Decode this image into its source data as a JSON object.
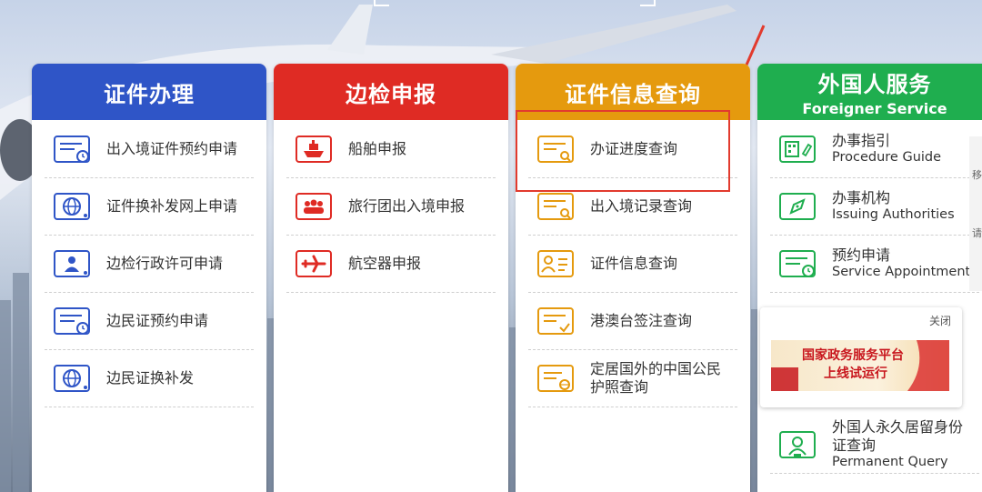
{
  "columns": [
    {
      "title": "证件办理",
      "color": "#2f55c7",
      "items": [
        {
          "label": "出入境证件预约申请",
          "icon": "document-clock-icon"
        },
        {
          "label": "证件换补发网上申请",
          "icon": "globe-icon"
        },
        {
          "label": "边检行政许可申请",
          "icon": "person-id-icon"
        },
        {
          "label": "边民证预约申请",
          "icon": "document-clock-icon"
        },
        {
          "label": "边民证换补发",
          "icon": "globe-icon"
        }
      ]
    },
    {
      "title": "边检申报",
      "color": "#df2b24",
      "items": [
        {
          "label": "船舶申报",
          "icon": "ship-icon"
        },
        {
          "label": "旅行团出入境申报",
          "icon": "group-icon"
        },
        {
          "label": "航空器申报",
          "icon": "airplane-icon"
        }
      ]
    },
    {
      "title": "证件信息查询",
      "color": "#e59a0e",
      "items": [
        {
          "label": "办证进度查询",
          "icon": "document-search-icon"
        },
        {
          "label": "出入境记录查询",
          "icon": "document-search-icon"
        },
        {
          "label": "证件信息查询",
          "icon": "person-card-icon"
        },
        {
          "label": "港澳台签注查询",
          "icon": "document-check-icon"
        },
        {
          "label": "定居国外的中国公民护照查询",
          "line1": "定居国外的中国公民",
          "line2": "护照查询",
          "icon": "passport-globe-icon"
        }
      ]
    },
    {
      "title": "外国人服务",
      "subtitle": "Foreigner Service",
      "color": "#1fae4f",
      "items": [
        {
          "label": "办事指引",
          "sub": "Procedure Guide",
          "icon": "guide-icon"
        },
        {
          "label": "办事机构",
          "sub": "Issuing Authorities",
          "icon": "compass-icon"
        },
        {
          "label": "预约申请",
          "sub": "Service Appointment",
          "icon": "document-clock-icon"
        },
        {
          "label": "外国人永久居留身份证查询",
          "line1": "外国人永久居留身份",
          "line2": "证查询",
          "sub": "Permanent Query",
          "icon": "resident-card-icon"
        }
      ]
    }
  ],
  "popup": {
    "close_label": "关闭",
    "banner_line1": "国家政务服务平台",
    "banner_line2": "上线试运行"
  },
  "side_tab": {
    "char1": "移",
    "char2": "请"
  },
  "colors": {
    "annotation": "#e23b2e"
  }
}
